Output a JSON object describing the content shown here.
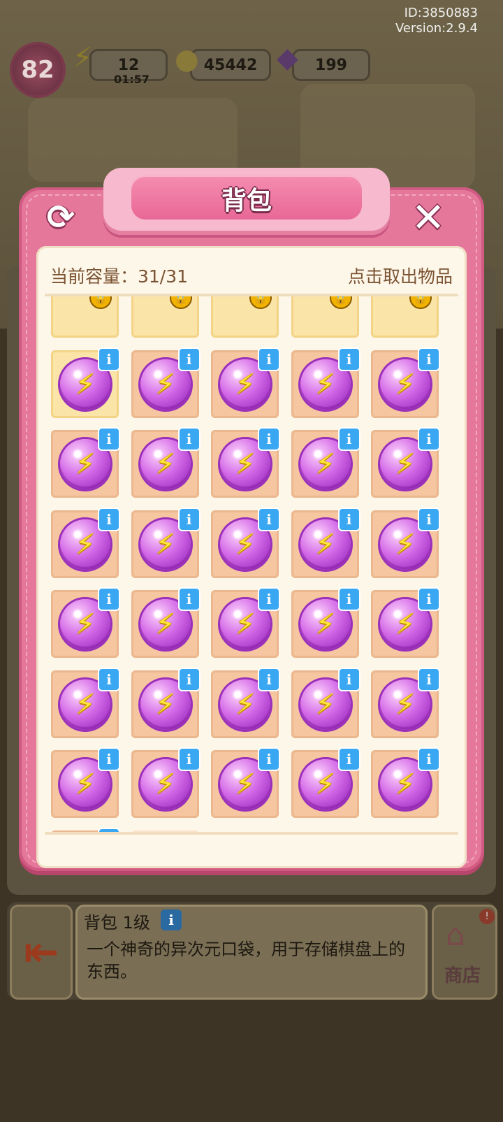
{
  "header": {
    "user_id": "ID:3850883",
    "version": "Version:2.9.4"
  },
  "stats": {
    "level": "82",
    "energy": "12",
    "energy_timer": "01:57",
    "coins": "45442",
    "gems": "199"
  },
  "panel": {
    "title": "背包",
    "capacity_label": "当前容量：31/31",
    "hint": "点击取出物品",
    "locked_slots": 5,
    "item_count": 31,
    "item_icon": "energy-orb-icon",
    "info_label": "i"
  },
  "bottom": {
    "item_title": "背包 1级",
    "description": "一个神奇的异次元口袋，用于存储棋盘上的东西。",
    "shop_label": "商店"
  },
  "colors": {
    "panel_pink": "#e4779a",
    "cell_peach": "#f6c6a0",
    "orb_purple": "#d46be8",
    "info_blue": "#3aa7f2"
  }
}
